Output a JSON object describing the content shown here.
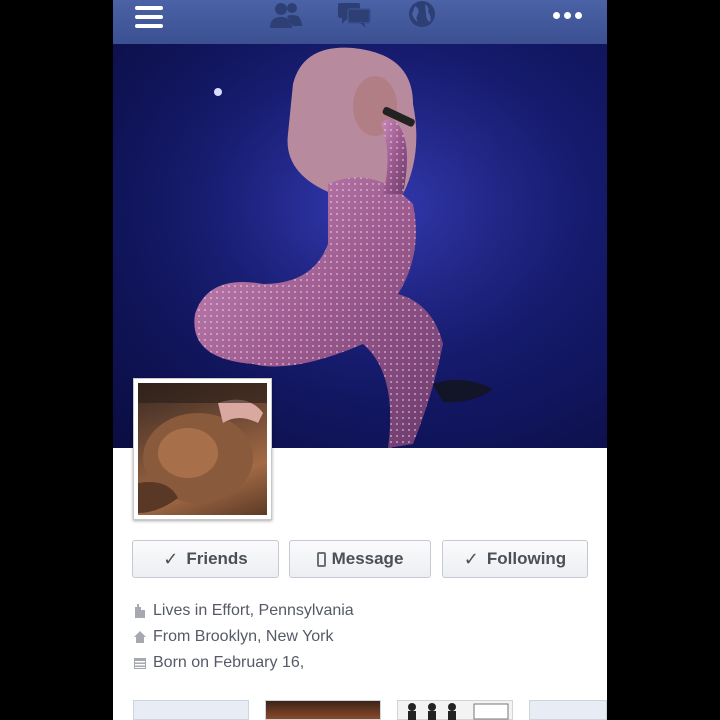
{
  "topbar": {
    "icons": [
      "menu-icon",
      "friends-icon",
      "messages-icon",
      "globe-icon",
      "more-icon"
    ],
    "color": "#3b5998"
  },
  "profile": {
    "buttons": {
      "friends": "Friends",
      "message": "Message",
      "following": "Following"
    },
    "info": {
      "lives_in": "Lives in Effort, Pennsylvania",
      "from": "From Brooklyn, New York",
      "born": "Born on February 16,"
    }
  },
  "photos_row": {
    "count_visible": 4
  }
}
